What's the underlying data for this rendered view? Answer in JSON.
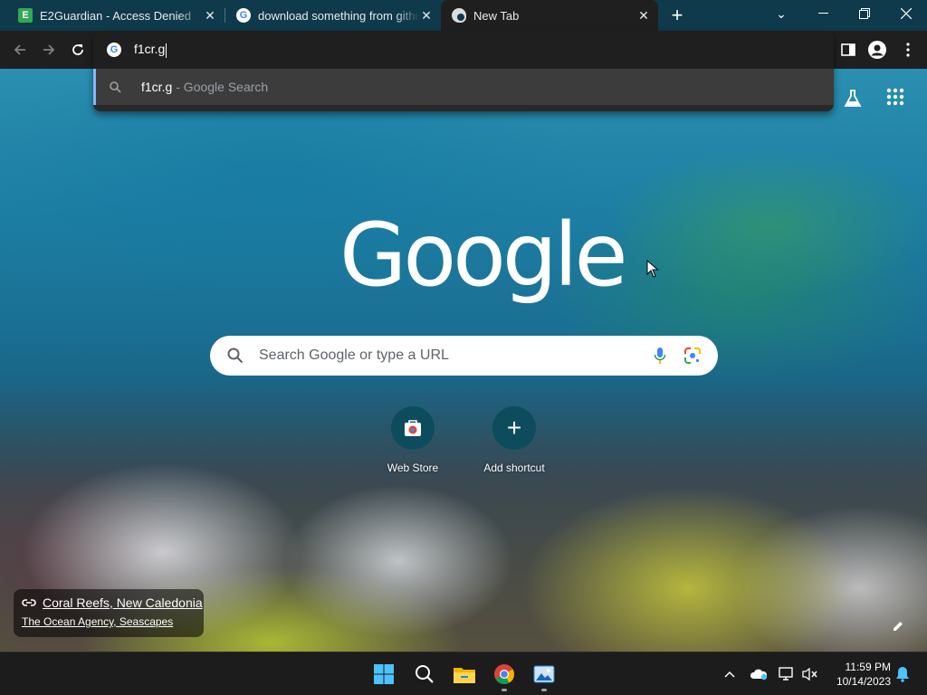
{
  "browser": {
    "tabs": [
      {
        "title": "E2Guardian - Access Denied",
        "favicon": "e2guardian-icon",
        "active": false
      },
      {
        "title": "download something from github",
        "favicon": "google-icon",
        "active": false
      },
      {
        "title": "New Tab",
        "favicon": "chrome-icon",
        "active": true
      }
    ],
    "new_tab_label": "+",
    "window_controls": {
      "tabsearch": "⌄",
      "minimize": "—",
      "restore": "❐",
      "close": "✕"
    }
  },
  "omnibox": {
    "typed": "f1cr.g",
    "suggestion_main": "f1cr.g",
    "suggestion_sub": "- Google Search"
  },
  "newtab": {
    "logo": "Google",
    "search_placeholder": "Search Google or type a URL",
    "shortcuts": [
      {
        "label": "Web Store",
        "icon": "web-store-icon"
      },
      {
        "label": "Add shortcut",
        "icon": "plus-icon"
      }
    ],
    "attribution": {
      "title": "Coral Reefs, New Caledonia",
      "credit": "The Ocean Agency, Seascapes"
    }
  },
  "taskbar": {
    "apps": [
      "start-icon",
      "search-icon",
      "file-explorer-icon",
      "chrome-icon",
      "photos-icon"
    ],
    "time": "11:59 PM",
    "date": "10/14/2023"
  },
  "colors": {
    "titlebar": "#0e3a4b",
    "toolbar": "#1f1f1f",
    "accent": "#8ab4f8"
  }
}
